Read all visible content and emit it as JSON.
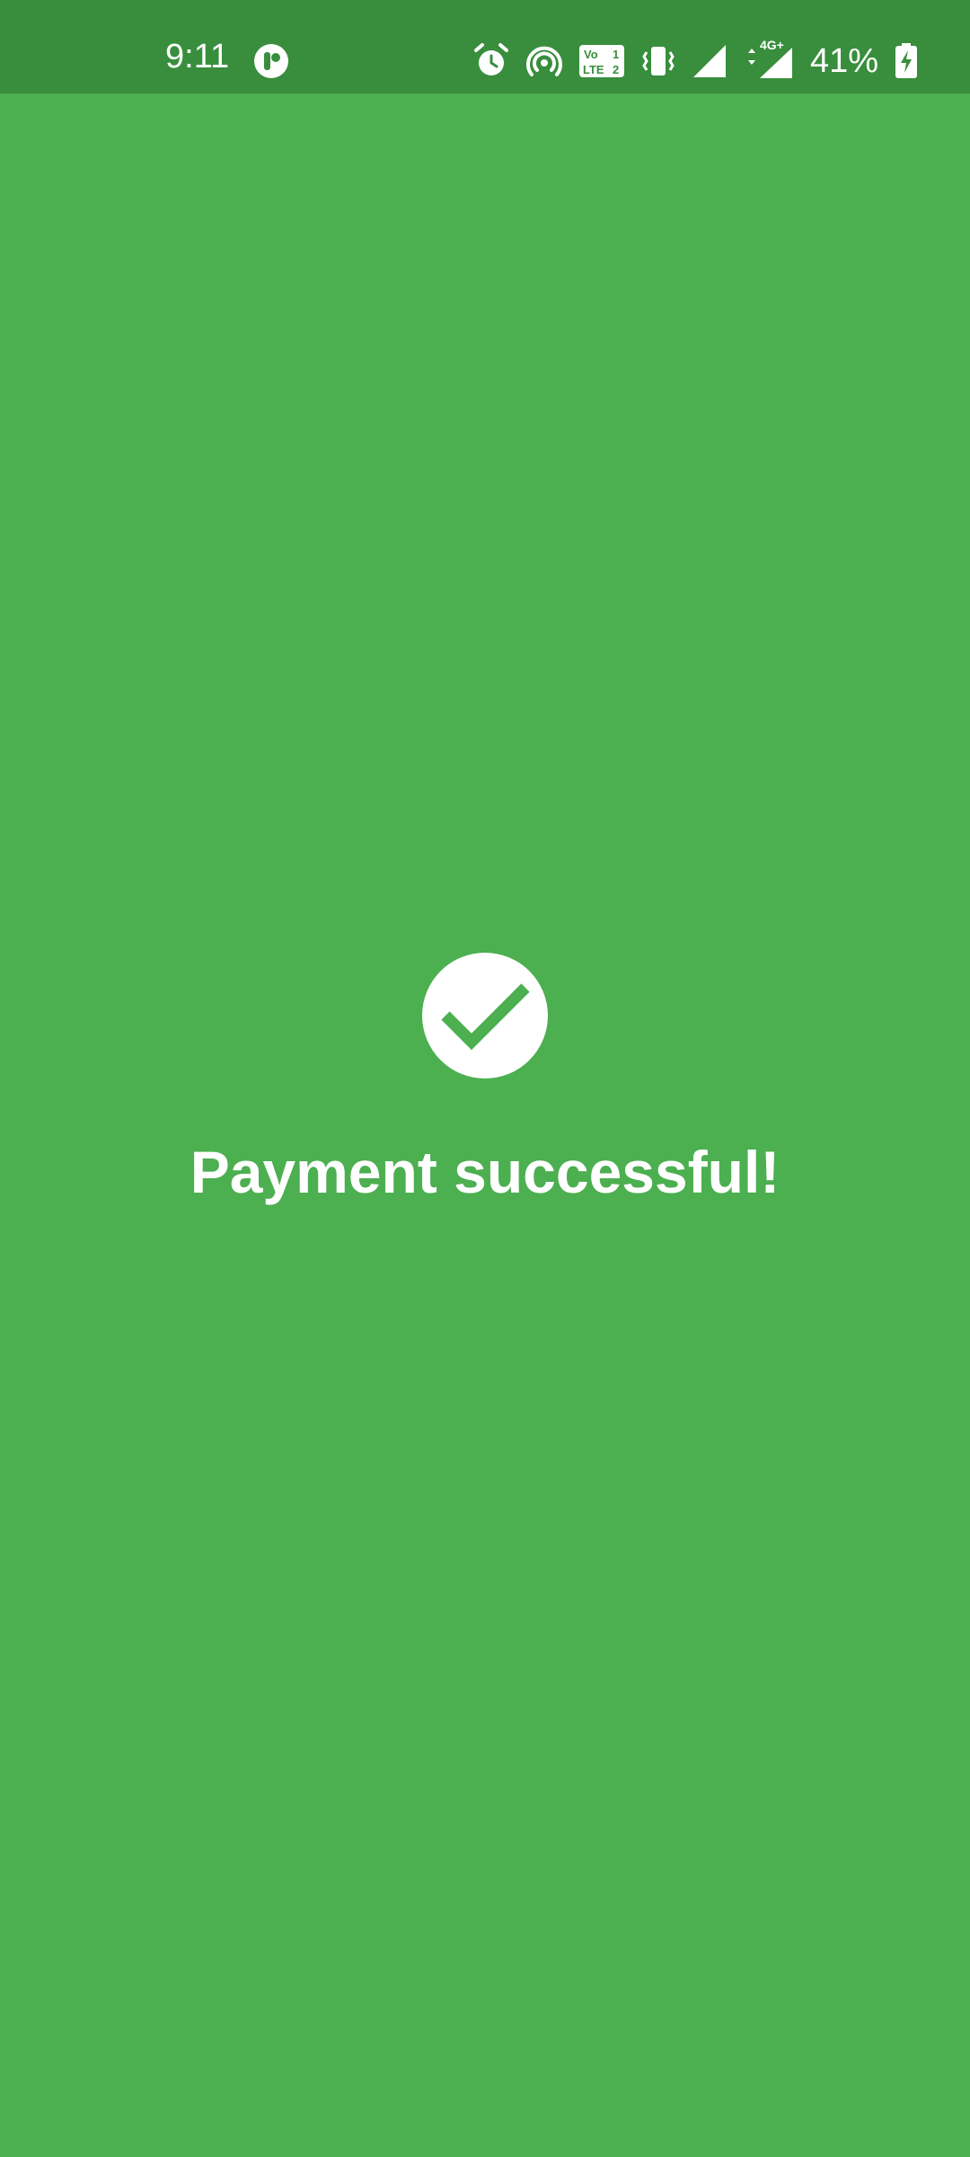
{
  "status_bar": {
    "time": "9:11",
    "battery_percent": "41%",
    "network_label": "4G+",
    "icons": [
      "app-notification-icon",
      "alarm-icon",
      "hotspot-icon",
      "volte-icon",
      "vibrate-icon",
      "signal-icon",
      "signal-4g-icon",
      "battery-charging-icon"
    ]
  },
  "main": {
    "status_icon": "check-circle-icon",
    "message": "Payment successful!"
  },
  "colors": {
    "background": "#4caf50",
    "status_bar": "#388e3c",
    "foreground": "#ffffff"
  }
}
